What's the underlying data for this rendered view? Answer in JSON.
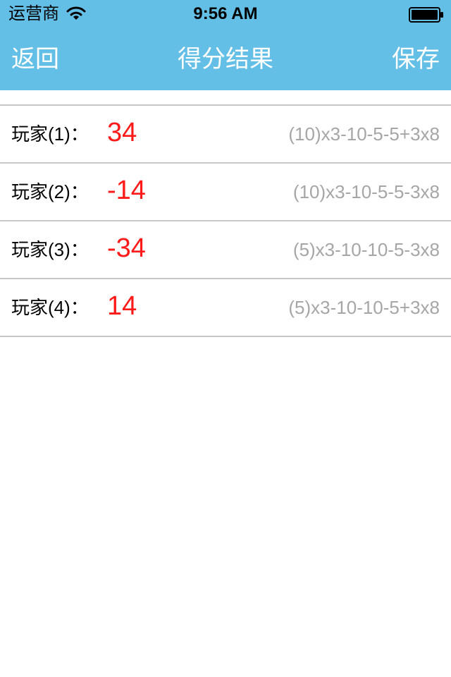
{
  "status_bar": {
    "carrier": "运营商",
    "time": "9:56 AM"
  },
  "nav": {
    "back_label": "返回",
    "title": "得分结果",
    "save_label": "保存"
  },
  "results": [
    {
      "label": "玩家(1)：",
      "score": "34",
      "formula": "(10)x3-10-5-5+3x8"
    },
    {
      "label": "玩家(2)：",
      "score": "-14",
      "formula": "(10)x3-10-5-5-3x8"
    },
    {
      "label": "玩家(3)：",
      "score": "-34",
      "formula": "(5)x3-10-10-5-3x8"
    },
    {
      "label": "玩家(4)：",
      "score": "14",
      "formula": "(5)x3-10-10-5+3x8"
    }
  ],
  "colors": {
    "nav_background": "#64bfe6",
    "score": "#ff1a1a",
    "formula": "#a6a6a6",
    "divider": "#c8c8c8"
  },
  "icons": {
    "wifi": "wifi-icon",
    "battery": "battery-icon"
  }
}
